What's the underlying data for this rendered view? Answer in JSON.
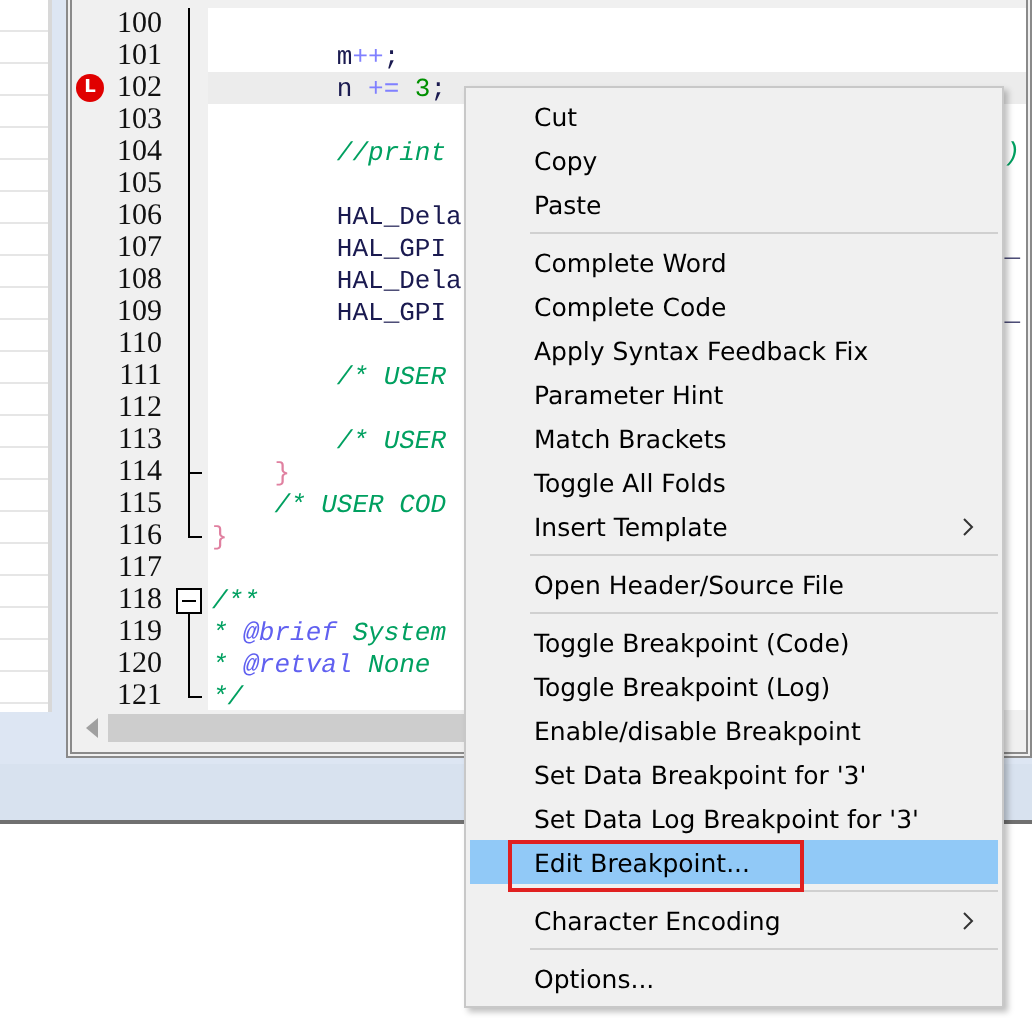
{
  "editor": {
    "lines": [
      {
        "number": "100",
        "kind": "fold-body"
      },
      {
        "number": "101",
        "kind": "fold-body",
        "segments": [
          {
            "text": "        m",
            "kind": "text"
          },
          {
            "text": "++",
            "kind": "op"
          },
          {
            "text": ";",
            "kind": "text"
          }
        ]
      },
      {
        "number": "102",
        "kind": "fold-body",
        "current": true,
        "breakpoint": "L",
        "segments": [
          {
            "text": "        n ",
            "kind": "text"
          },
          {
            "text": "+=",
            "kind": "op"
          },
          {
            "text": " 3",
            "kind": "num"
          },
          {
            "text": ";",
            "kind": "text"
          }
        ]
      },
      {
        "number": "103",
        "kind": "fold-body"
      },
      {
        "number": "104",
        "kind": "fold-body",
        "segments": [
          {
            "text": "        //print",
            "kind": "comment"
          }
        ],
        "tail": {
          "text": ")",
          "kind": "comment"
        }
      },
      {
        "number": "105",
        "kind": "fold-body"
      },
      {
        "number": "106",
        "kind": "fold-body",
        "segments": [
          {
            "text": "        HAL_Dela",
            "kind": "text"
          }
        ]
      },
      {
        "number": "107",
        "kind": "fold-body",
        "segments": [
          {
            "text": "        HAL_GPI",
            "kind": "text"
          }
        ],
        "tail": {
          "text": "_",
          "kind": "text"
        }
      },
      {
        "number": "108",
        "kind": "fold-body",
        "segments": [
          {
            "text": "        HAL_Dela",
            "kind": "text"
          }
        ]
      },
      {
        "number": "109",
        "kind": "fold-body",
        "segments": [
          {
            "text": "        HAL_GPI",
            "kind": "text"
          }
        ],
        "tail": {
          "text": "_",
          "kind": "text"
        }
      },
      {
        "number": "110",
        "kind": "fold-body"
      },
      {
        "number": "111",
        "kind": "fold-body",
        "segments": [
          {
            "text": "        /* USER",
            "kind": "comment"
          }
        ]
      },
      {
        "number": "112",
        "kind": "fold-body"
      },
      {
        "number": "113",
        "kind": "fold-body",
        "segments": [
          {
            "text": "        /* USER",
            "kind": "comment"
          }
        ]
      },
      {
        "number": "114",
        "kind": "fold-branch",
        "segments": [
          {
            "text": "    }",
            "kind": "brace"
          }
        ]
      },
      {
        "number": "115",
        "kind": "fold-body",
        "segments": [
          {
            "text": "    /* USER COD",
            "kind": "comment"
          }
        ]
      },
      {
        "number": "116",
        "kind": "fold-end",
        "segments": [
          {
            "text": "}",
            "kind": "brace"
          }
        ]
      },
      {
        "number": "117",
        "kind": "plain"
      },
      {
        "number": "118",
        "kind": "fold-start",
        "segments": [
          {
            "text": "/**",
            "kind": "comment"
          }
        ]
      },
      {
        "number": "119",
        "kind": "fold-body",
        "segments": [
          {
            "text": "* ",
            "kind": "comment"
          },
          {
            "text": "@brief",
            "kind": "doctag"
          },
          {
            "text": " System",
            "kind": "comment"
          }
        ]
      },
      {
        "number": "120",
        "kind": "fold-body",
        "segments": [
          {
            "text": "* ",
            "kind": "comment"
          },
          {
            "text": "@retval",
            "kind": "doctag"
          },
          {
            "text": " None",
            "kind": "comment"
          }
        ]
      },
      {
        "number": "121",
        "kind": "fold-end",
        "segments": [
          {
            "text": "*/",
            "kind": "comment"
          }
        ]
      }
    ]
  },
  "context_menu": {
    "items": [
      {
        "kind": "item",
        "label": "Cut",
        "selected": false,
        "submenu": false,
        "annotated": false
      },
      {
        "kind": "item",
        "label": "Copy",
        "selected": false,
        "submenu": false,
        "annotated": false
      },
      {
        "kind": "item",
        "label": "Paste",
        "selected": false,
        "submenu": false,
        "annotated": false
      },
      {
        "kind": "separator"
      },
      {
        "kind": "item",
        "label": "Complete Word",
        "selected": false,
        "submenu": false,
        "annotated": false
      },
      {
        "kind": "item",
        "label": "Complete Code",
        "selected": false,
        "submenu": false,
        "annotated": false
      },
      {
        "kind": "item",
        "label": "Apply Syntax Feedback Fix",
        "selected": false,
        "submenu": false,
        "annotated": false
      },
      {
        "kind": "item",
        "label": "Parameter Hint",
        "selected": false,
        "submenu": false,
        "annotated": false
      },
      {
        "kind": "item",
        "label": "Match Brackets",
        "selected": false,
        "submenu": false,
        "annotated": false
      },
      {
        "kind": "item",
        "label": "Toggle All Folds",
        "selected": false,
        "submenu": false,
        "annotated": false
      },
      {
        "kind": "item",
        "label": "Insert Template",
        "selected": false,
        "submenu": true,
        "annotated": false
      },
      {
        "kind": "separator"
      },
      {
        "kind": "item",
        "label": "Open Header/Source File",
        "selected": false,
        "submenu": false,
        "annotated": false
      },
      {
        "kind": "separator"
      },
      {
        "kind": "item",
        "label": "Toggle Breakpoint (Code)",
        "selected": false,
        "submenu": false,
        "annotated": false
      },
      {
        "kind": "item",
        "label": "Toggle Breakpoint (Log)",
        "selected": false,
        "submenu": false,
        "annotated": false
      },
      {
        "kind": "item",
        "label": "Enable/disable Breakpoint",
        "selected": false,
        "submenu": false,
        "annotated": false
      },
      {
        "kind": "item",
        "label": "Set Data Breakpoint for '3'",
        "selected": false,
        "submenu": false,
        "annotated": false
      },
      {
        "kind": "item",
        "label": "Set Data Log Breakpoint for '3'",
        "selected": false,
        "submenu": false,
        "annotated": false
      },
      {
        "kind": "item",
        "label": "Edit Breakpoint...",
        "selected": true,
        "submenu": false,
        "annotated": true
      },
      {
        "kind": "separator"
      },
      {
        "kind": "item",
        "label": "Character Encoding",
        "selected": false,
        "submenu": true,
        "annotated": false
      },
      {
        "kind": "separator"
      },
      {
        "kind": "item",
        "label": "Options...",
        "selected": false,
        "submenu": false,
        "annotated": false
      }
    ]
  }
}
